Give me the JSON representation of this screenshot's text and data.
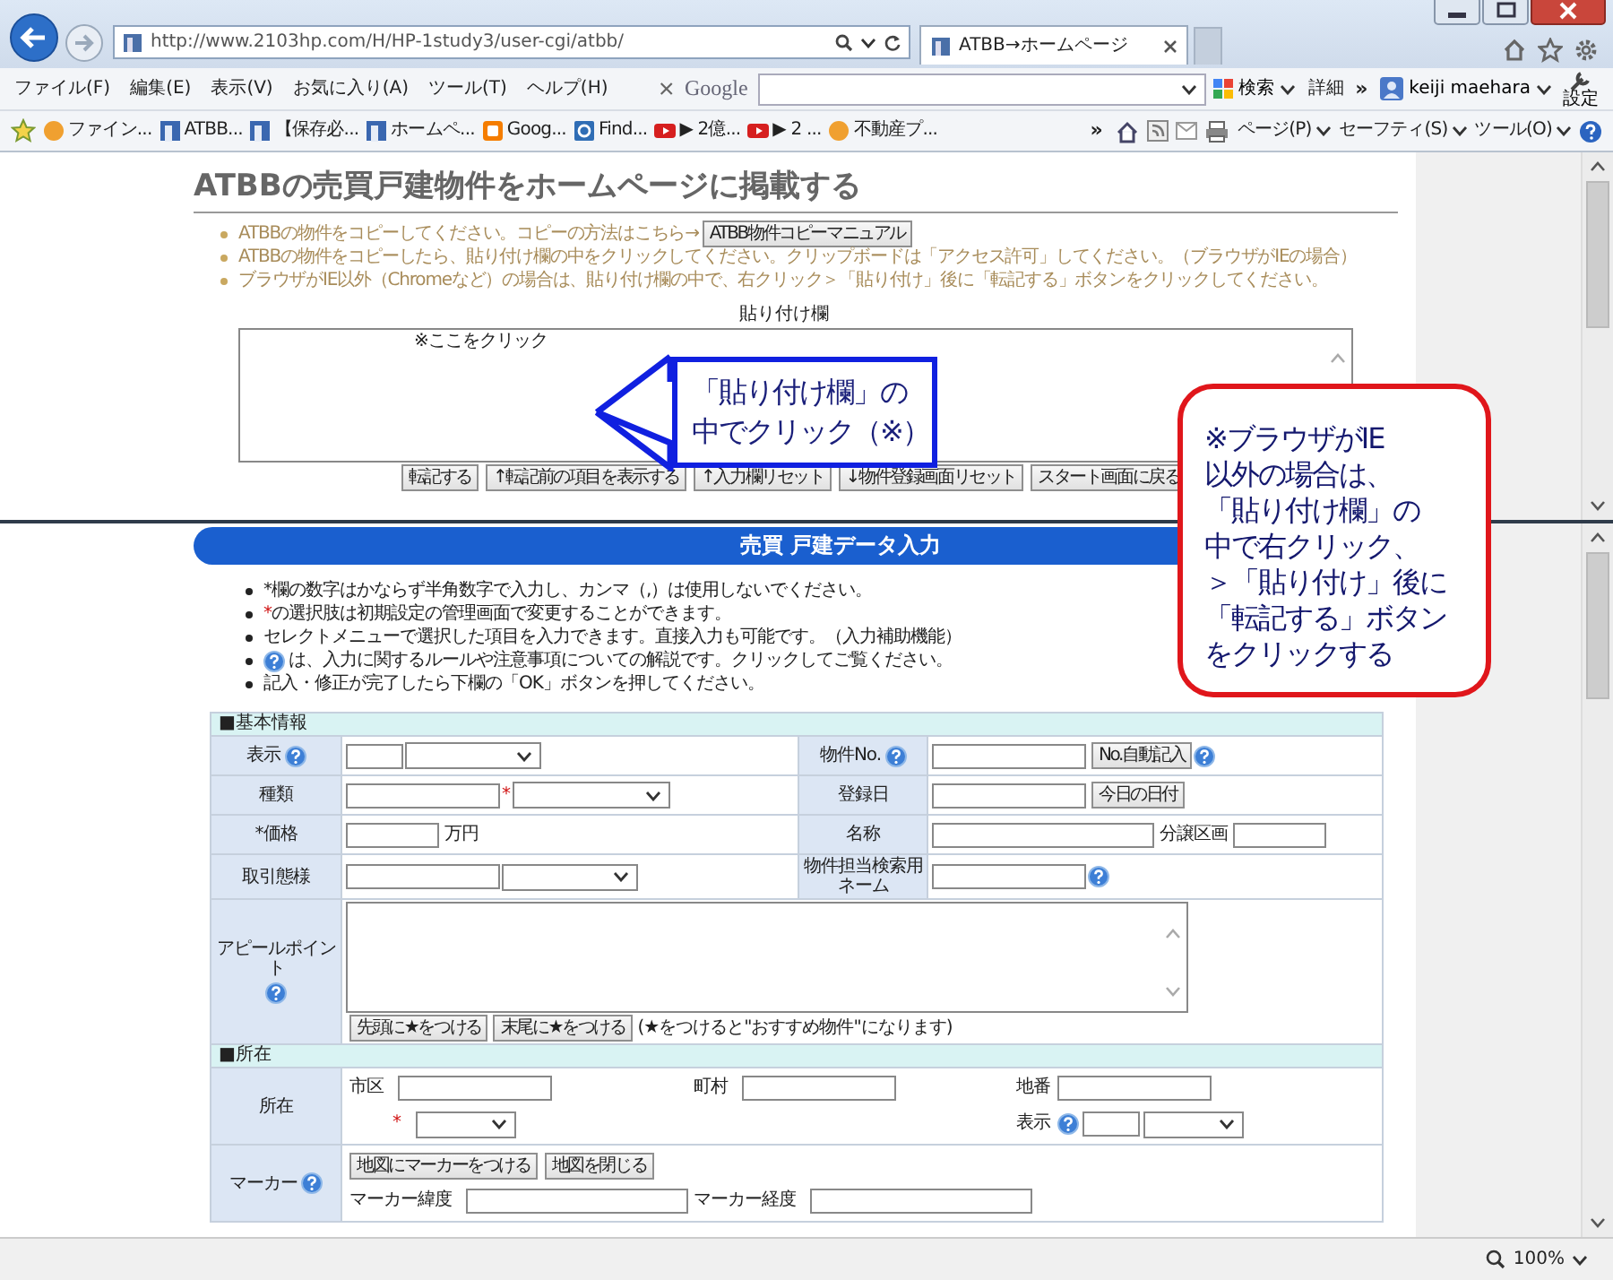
{
  "browser": {
    "address": "http://www.2103hp.com/H/HP-1study3/user-cgi/atbb/",
    "tab": "ATBB→ホームページ",
    "menu": [
      "ファイル(F)",
      "編集(E)",
      "表示(V)",
      "お気に入り(A)",
      "ツール(T)",
      "ヘルプ(H)"
    ],
    "toolbar": {
      "logo": "Google",
      "search_button": "検索",
      "details": "詳細",
      "more": "»",
      "user": "keiji maehara",
      "settings": "設定"
    },
    "favorites": [
      {
        "kind": "circle",
        "label": "ファイン..."
      },
      {
        "kind": "site",
        "label": "ATBB..."
      },
      {
        "kind": "site",
        "label": "【保存必..."
      },
      {
        "kind": "site",
        "label": "ホームペ..."
      },
      {
        "kind": "blog",
        "label": "Goog..."
      },
      {
        "kind": "globe",
        "label": "Find..."
      },
      {
        "kind": "video",
        "label": "▶ 2億..."
      },
      {
        "kind": "video",
        "label": "▶ 2 ..."
      },
      {
        "kind": "circle",
        "label": "不動産プ..."
      }
    ],
    "favorites_more": "»",
    "commands": [
      "ページ(P)",
      "セーフティ(S)",
      "ツール(O)"
    ]
  },
  "top_frame": {
    "title": "ATBBの売買戸建物件をホームページに掲載する",
    "instructions": [
      {
        "text": "ATBBの物件をコピーしてください。コピーの方法はこちら→",
        "button": "ATBB物件コピーマニュアル"
      },
      {
        "text": "ATBBの物件をコピーしたら、貼り付け欄の中をクリックしてください。クリップボードは「アクセス許可」してください。（ブラウザがIEの場合）"
      },
      {
        "text": "ブラウザがIE以外（Chromeなど）の場合は、貼り付け欄の中で、右クリック＞「貼り付け」後に「転記する」ボタンをクリックしてください。"
      }
    ],
    "paste_label": "貼り付け欄",
    "paste_placeholder": "※ここをクリック",
    "buttons": [
      "転記する",
      "↑転記前の項目を表示する",
      "↑入力欄リセット",
      "↓物件登録画面リセット",
      "スタート画面に戻る"
    ]
  },
  "bottom_frame": {
    "header": "売買 戸建データ入力",
    "notes": [
      {
        "text": "*欄の数字はかならず半角数字で入力し、カンマ（,）は使用しないでください。"
      },
      {
        "mark": "*",
        "text": "の選択肢は初期設定の管理画面で変更することができます。"
      },
      {
        "text": "セレクトメニューで選択した項目を入力できます。直接入力も可能です。（入力補助機能）"
      },
      {
        "help": true,
        "text": "は、入力に関するルールや注意事項についての解説です。クリックしてご覧ください。"
      },
      {
        "text": "記入・修正が完了したら下欄の「OK」ボタンを押してください。"
      }
    ],
    "sections": [
      {
        "title": "■基本情報",
        "rows": [
          {
            "fields": [
              {
                "label": "表示",
                "help": true,
                "items": [
                  {
                    "kind": "tinyinput"
                  },
                  {
                    "kind": "select"
                  }
                ]
              },
              {
                "label": "物件No.",
                "help": true,
                "items": [
                  {
                    "kind": "input"
                  },
                  {
                    "kind": "button",
                    "text": "No.自動記入"
                  },
                  {
                    "kind": "help"
                  }
                ]
              }
            ]
          },
          {
            "fields": [
              {
                "label": "種類",
                "items": [
                  {
                    "kind": "input"
                  },
                  {
                    "kind": "required",
                    "text": "*"
                  },
                  {
                    "kind": "wideselect"
                  }
                ]
              },
              {
                "label": "登録日",
                "items": [
                  {
                    "kind": "input"
                  },
                  {
                    "kind": "button",
                    "text": "今日の日付"
                  }
                ]
              }
            ]
          },
          {
            "fields": [
              {
                "label": "*価格",
                "items": [
                  {
                    "kind": "shortinput"
                  },
                  {
                    "kind": "text",
                    "text": "万円"
                  }
                ]
              },
              {
                "label": "名称",
                "items": [
                  {
                    "kind": "wideinput"
                  },
                  {
                    "kind": "text",
                    "text": "分譲区画"
                  },
                  {
                    "kind": "shortinput"
                  }
                ]
              }
            ]
          },
          {
            "fields": [
              {
                "label": "取引態様",
                "items": [
                  {
                    "kind": "input"
                  },
                  {
                    "kind": "select"
                  }
                ]
              },
              {
                "label": "物件担当検索用ネーム",
                "items": [
                  {
                    "kind": "input"
                  },
                  {
                    "kind": "help"
                  }
                ]
              }
            ]
          },
          {
            "fields": [
              {
                "label": "アピールポイント",
                "help": true,
                "items": [
                  {
                    "kind": "textarea"
                  },
                  {
                    "kind": "button",
                    "text": "先頭に★をつける"
                  },
                  {
                    "kind": "button",
                    "text": "末尾に★をつける"
                  },
                  {
                    "kind": "text",
                    "text": "(★をつけると\"おすすめ物件\"になります)"
                  }
                ]
              }
            ]
          }
        ]
      },
      {
        "title": "■所在",
        "rows": [
          {
            "fields": [
              {
                "label": "所在",
                "lines": [
                  [
                    {
                      "kind": "left",
                      "items": [
                        {
                          "kind": "text",
                          "text": "市区"
                        },
                        {
                          "kind": "input"
                        }
                      ]
                    },
                    {
                      "kind": "middle",
                      "items": [
                        {
                          "kind": "text",
                          "text": "町村"
                        },
                        {
                          "kind": "input"
                        }
                      ]
                    },
                    {
                      "kind": "right",
                      "items": [
                        {
                          "kind": "text",
                          "text": "地番"
                        },
                        {
                          "kind": "input"
                        }
                      ]
                    }
                  ],
                  [
                    {
                      "kind": "left",
                      "items": [
                        {
                          "kind": "required",
                          "text": "*"
                        },
                        {
                          "kind": "shortselect"
                        }
                      ]
                    },
                    {
                      "kind": "right",
                      "items": [
                        {
                          "kind": "text",
                          "text": "表示"
                        },
                        {
                          "kind": "help"
                        },
                        {
                          "kind": "tinyinput"
                        },
                        {
                          "kind": "shortselect"
                        }
                      ]
                    }
                  ]
                ]
              }
            ]
          },
          {
            "fields": [
              {
                "label": "マーカー",
                "help": true,
                "lines": [
                  [
                    {
                      "kind": "left",
                      "items": [
                        {
                          "kind": "button",
                          "text": "地図にマーカーをつける"
                        },
                        {
                          "kind": "button",
                          "text": "地図を閉じる"
                        }
                      ]
                    }
                  ],
                  [
                    {
                      "kind": "left",
                      "items": [
                        {
                          "kind": "text",
                          "text": "マーカー緯度"
                        },
                        {
                          "kind": "wideinput"
                        }
                      ]
                    },
                    {
                      "kind": "middle",
                      "items": [
                        {
                          "kind": "text",
                          "text": "マーカー経度"
                        },
                        {
                          "kind": "wideinput"
                        }
                      ]
                    }
                  ]
                ]
              }
            ]
          }
        ]
      }
    ]
  },
  "callouts": [
    {
      "kind": "arrow",
      "lines": [
        "「貼り付け欄」の",
        "中でクリック（※）"
      ]
    },
    {
      "kind": "box",
      "lines": [
        "※ブラウザがIE",
        "以外の場合は、",
        "「貼り付け欄」の",
        "中で右クリック、",
        "＞「貼り付け」後に",
        "「転記する」ボタン",
        "をクリックする"
      ]
    }
  ],
  "status_bar": {
    "zoom": "100%"
  }
}
